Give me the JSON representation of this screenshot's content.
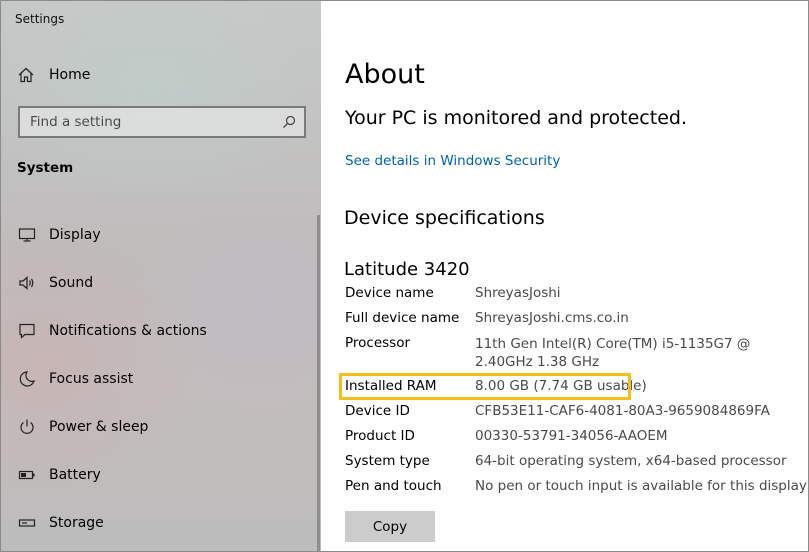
{
  "window": {
    "title": "Settings"
  },
  "sidebar": {
    "home_label": "Home",
    "search_placeholder": "Find a setting",
    "section_title": "System",
    "items": [
      {
        "label": "Display",
        "icon": "display-icon"
      },
      {
        "label": "Sound",
        "icon": "speaker-icon"
      },
      {
        "label": "Notifications & actions",
        "icon": "notification-icon"
      },
      {
        "label": "Focus assist",
        "icon": "moon-icon"
      },
      {
        "label": "Power & sleep",
        "icon": "power-icon"
      },
      {
        "label": "Battery",
        "icon": "battery-icon"
      },
      {
        "label": "Storage",
        "icon": "storage-icon"
      }
    ]
  },
  "main": {
    "title": "About",
    "protection_status": "Your PC is monitored and protected.",
    "security_link": "See details in Windows Security",
    "specs_heading": "Device specifications",
    "model": "Latitude 3420",
    "specs": [
      {
        "label": "Device name",
        "value": "ShreyasJoshi"
      },
      {
        "label": "Full device name",
        "value": "ShreyasJoshi.cms.co.in"
      },
      {
        "label": "Processor",
        "value": "11th Gen Intel(R) Core(TM) i5-1135G7 @ 2.40GHz 1.38 GHz"
      },
      {
        "label": "Installed RAM",
        "value": "8.00 GB (7.74 GB usable)"
      },
      {
        "label": "Device ID",
        "value": "CFB53E11-CAF6-4081-80A3-9659084869FA"
      },
      {
        "label": "Product ID",
        "value": "00330-53791-34056-AAOEM"
      },
      {
        "label": "System type",
        "value": "64-bit operating system, x64-based processor"
      },
      {
        "label": "Pen and touch",
        "value": "No pen or touch input is available for this display"
      }
    ],
    "copy_label": "Copy",
    "highlight_color": "#f2c21b",
    "link_color": "#0063b1"
  }
}
